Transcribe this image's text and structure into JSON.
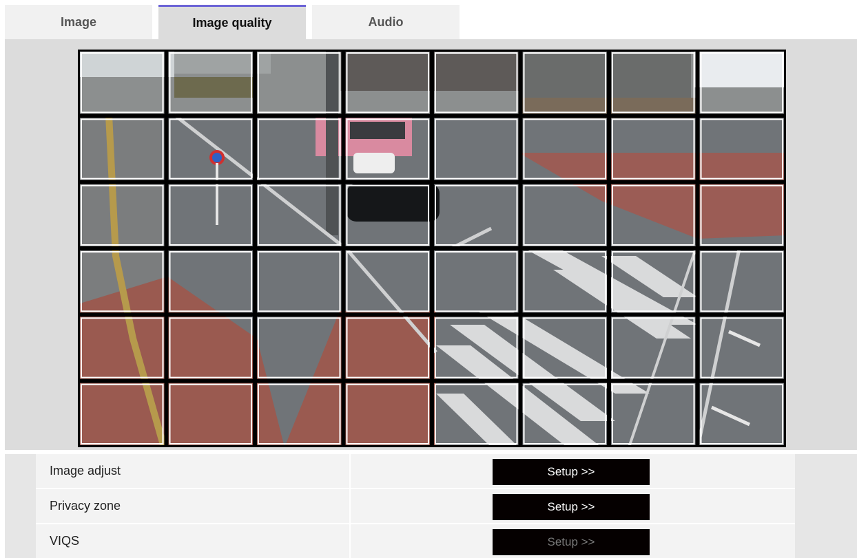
{
  "tabs": [
    {
      "label": "Image",
      "active": false
    },
    {
      "label": "Image quality",
      "active": true
    },
    {
      "label": "Audio",
      "active": false
    }
  ],
  "preview": {
    "grid": {
      "rows": 6,
      "cols": 8
    },
    "selected_cells": "all"
  },
  "settings": [
    {
      "label": "Image adjust",
      "button": "Setup >>",
      "enabled": true
    },
    {
      "label": "Privacy zone",
      "button": "Setup >>",
      "enabled": true
    },
    {
      "label": "VIQS",
      "button": "Setup >>",
      "enabled": false
    }
  ],
  "colors": {
    "active_tab_accent": "#6b63d6",
    "button_bg": "#050000",
    "stage_bg": "#dcdcdc"
  }
}
